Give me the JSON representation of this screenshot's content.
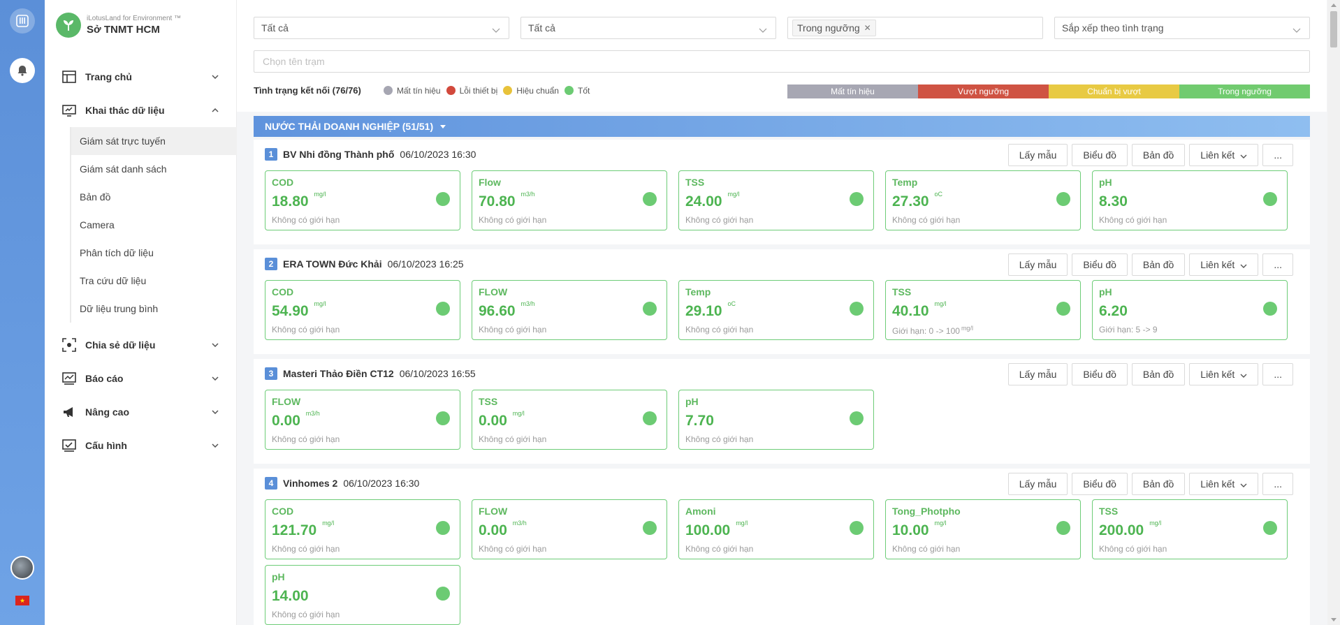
{
  "brand": {
    "subtitle": "iLotusLand for Environment ™",
    "title": "Sở TNMT HCM"
  },
  "nav": {
    "home": "Trang chủ",
    "data_mining": "Khai thác dữ liệu",
    "sub": [
      "Giám sát trực tuyến",
      "Giám sát danh sách",
      "Bản đồ",
      "Camera",
      "Phân tích dữ liệu",
      "Tra cứu dữ liệu",
      "Dữ liệu trung bình"
    ],
    "share": "Chia sẻ dữ liệu",
    "report": "Báo cáo",
    "advanced": "Nâng cao",
    "config": "Cấu hình"
  },
  "filters": {
    "f1": "Tất cả",
    "f2": "Tất cả",
    "status_tag": "Trong ngưỡng",
    "sort": "Sắp xếp theo tình trạng",
    "search_placeholder": "Chọn tên trạm"
  },
  "connection": {
    "title": "Tình trạng kết nối (76/76)",
    "legend": [
      {
        "label": "Mất tín hiệu",
        "color": "#a6a6b2"
      },
      {
        "label": "Lỗi thiết bị",
        "color": "#d2493c"
      },
      {
        "label": "Hiệu chuẩn",
        "color": "#e8c23a"
      },
      {
        "label": "Tốt",
        "color": "#6ccb73"
      }
    ]
  },
  "status_bar": [
    {
      "label": "Mất tín hiệu",
      "color": "#a7a7b3"
    },
    {
      "label": "Vượt ngưỡng",
      "color": "#cf5343"
    },
    {
      "label": "Chuẩn bị vượt",
      "color": "#e8ca43"
    },
    {
      "label": "Trong ngưỡng",
      "color": "#71cb6f"
    }
  ],
  "group": {
    "title": "NƯỚC THẢI DOANH NGHIỆP (51/51)"
  },
  "actions": {
    "sample": "Lấy mẫu",
    "chart": "Biểu đồ",
    "map": "Bản đồ",
    "link": "Liên kết",
    "more": "..."
  },
  "stations": [
    {
      "num": "1",
      "name": "BV Nhi đồng Thành phố",
      "time": "06/10/2023 16:30",
      "params": [
        {
          "name": "COD",
          "value": "18.80",
          "unit": "mg/l",
          "limit": "Không có giới hạn"
        },
        {
          "name": "Flow",
          "value": "70.80",
          "unit": "m3/h",
          "limit": "Không có giới hạn"
        },
        {
          "name": "TSS",
          "value": "24.00",
          "unit": "mg/l",
          "limit": "Không có giới hạn"
        },
        {
          "name": "Temp",
          "value": "27.30",
          "unit": "oC",
          "limit": "Không có giới hạn"
        },
        {
          "name": "pH",
          "value": "8.30",
          "unit": "",
          "limit": "Không có giới hạn"
        }
      ]
    },
    {
      "num": "2",
      "name": "ERA TOWN Đức Khải",
      "time": "06/10/2023 16:25",
      "params": [
        {
          "name": "COD",
          "value": "54.90",
          "unit": "mg/l",
          "limit": "Không có giới hạn"
        },
        {
          "name": "FLOW",
          "value": "96.60",
          "unit": "m3/h",
          "limit": "Không có giới hạn"
        },
        {
          "name": "Temp",
          "value": "29.10",
          "unit": "oC",
          "limit": "Không có giới hạn"
        },
        {
          "name": "TSS",
          "value": "40.10",
          "unit": "mg/l",
          "limit": "Giới hạn: 0 -> 100",
          "limit_unit": "mg/l"
        },
        {
          "name": "pH",
          "value": "6.20",
          "unit": "",
          "limit": "Giới hạn: 5 -> 9"
        }
      ]
    },
    {
      "num": "3",
      "name": "Masteri Thảo Điền CT12",
      "time": "06/10/2023 16:55",
      "params": [
        {
          "name": "FLOW",
          "value": "0.00",
          "unit": "m3/h",
          "limit": "Không có giới hạn"
        },
        {
          "name": "TSS",
          "value": "0.00",
          "unit": "mg/l",
          "limit": "Không có giới hạn"
        },
        {
          "name": "pH",
          "value": "7.70",
          "unit": "",
          "limit": "Không có giới hạn"
        }
      ]
    },
    {
      "num": "4",
      "name": "Vinhomes 2",
      "time": "06/10/2023 16:30",
      "params": [
        {
          "name": "COD",
          "value": "121.70",
          "unit": "mg/l",
          "limit": "Không có giới hạn"
        },
        {
          "name": "FLOW",
          "value": "0.00",
          "unit": "m3/h",
          "limit": "Không có giới hạn"
        },
        {
          "name": "Amoni",
          "value": "100.00",
          "unit": "mg/l",
          "limit": "Không có giới hạn"
        },
        {
          "name": "Tong_Photpho",
          "value": "10.00",
          "unit": "mg/l",
          "limit": "Không có giới hạn"
        },
        {
          "name": "TSS",
          "value": "200.00",
          "unit": "mg/l",
          "limit": "Không có giới hạn"
        },
        {
          "name": "pH",
          "value": "14.00",
          "unit": "",
          "limit": "Không có giới hạn"
        }
      ]
    }
  ]
}
